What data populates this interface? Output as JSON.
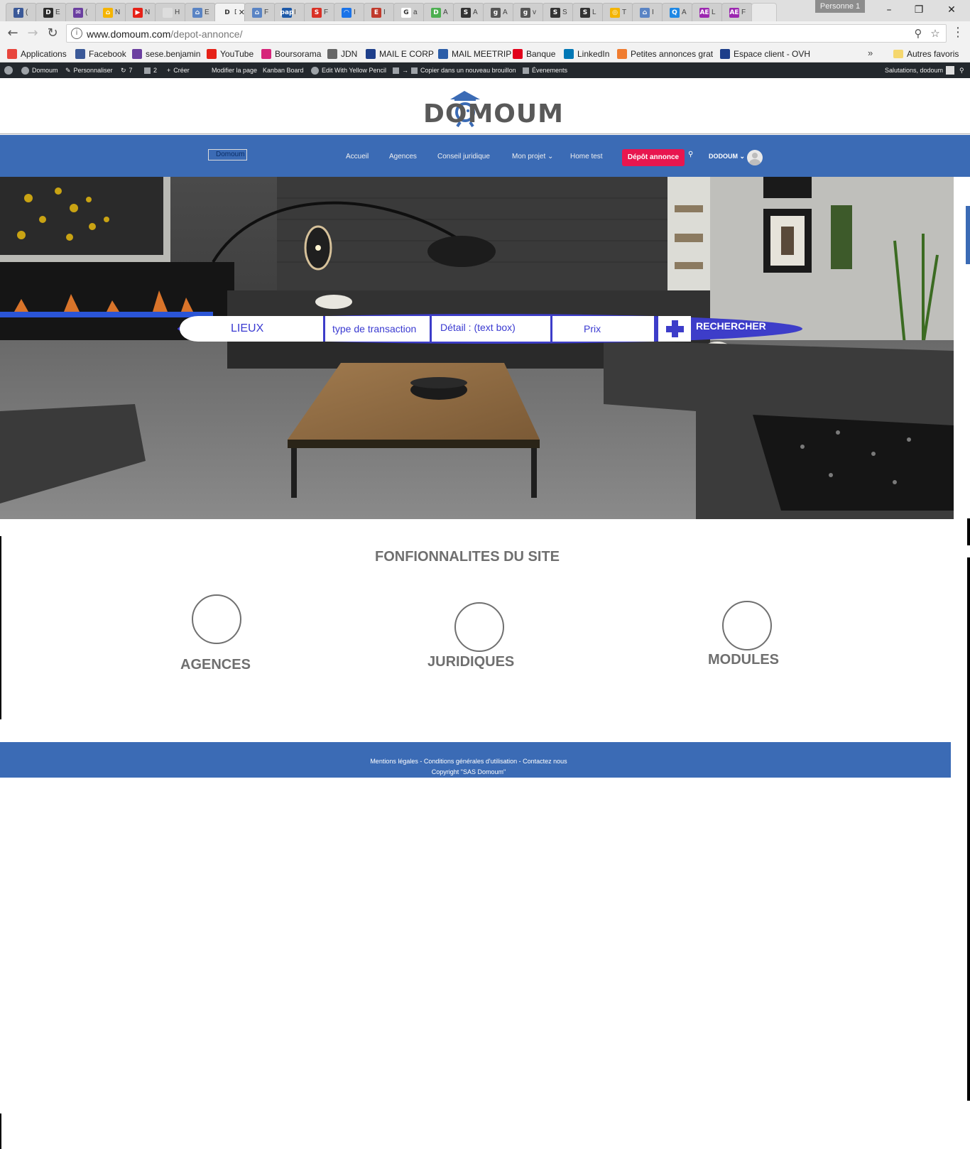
{
  "browser": {
    "tabs": [
      {
        "fav": "f",
        "color": "#3b5998",
        "label": "("
      },
      {
        "fav": "D",
        "color": "#2b2b2b",
        "label": "E"
      },
      {
        "fav": "✉",
        "color": "#6b3fa0",
        "label": "("
      },
      {
        "fav": "⌂",
        "color": "#f5b400",
        "label": "N"
      },
      {
        "fav": "▶",
        "color": "#e62117",
        "label": "N"
      },
      {
        "fav": "",
        "color": "#dddddd",
        "label": "H"
      },
      {
        "fav": "⌂",
        "color": "#5a84c4",
        "label": "E"
      },
      {
        "fav": "D",
        "color": "#f2f2f2",
        "label": "D",
        "active": true
      },
      {
        "fav": "⌂",
        "color": "#5a84c4",
        "label": "F"
      },
      {
        "fav": "pap",
        "color": "#1e5aa8",
        "label": "I"
      },
      {
        "fav": "S",
        "color": "#d93025",
        "label": "F"
      },
      {
        "fav": "◠",
        "color": "#1a73e8",
        "label": "I"
      },
      {
        "fav": "E",
        "color": "#c0392b",
        "label": "I"
      },
      {
        "fav": "G",
        "color": "#ffffff",
        "label": "a"
      },
      {
        "fav": "D",
        "color": "#4caf50",
        "label": "A"
      },
      {
        "fav": "S",
        "color": "#333333",
        "label": "A"
      },
      {
        "fav": "g",
        "color": "#555555",
        "label": "A"
      },
      {
        "fav": "g",
        "color": "#555555",
        "label": "v"
      },
      {
        "fav": "S",
        "color": "#333333",
        "label": "S"
      },
      {
        "fav": "S",
        "color": "#333333",
        "label": "L"
      },
      {
        "fav": "◎",
        "color": "#f4b400",
        "label": "T"
      },
      {
        "fav": "⌂",
        "color": "#5a84c4",
        "label": "I"
      },
      {
        "fav": "Q",
        "color": "#1e88e5",
        "label": "A"
      },
      {
        "fav": "AE",
        "color": "#9c27b0",
        "label": "L"
      },
      {
        "fav": "AE",
        "color": "#9c27b0",
        "label": "F"
      }
    ],
    "profile": "Personne 1",
    "url_host": "www.domoum.com",
    "url_path": "/depot-annonce/",
    "bookmarks": [
      {
        "label": "Applications",
        "icon": "apps-icon",
        "color": "#e8453c"
      },
      {
        "label": "Facebook",
        "icon": "facebook-icon",
        "color": "#3b5998"
      },
      {
        "label": "sese.benjamin",
        "icon": "mail-icon",
        "color": "#6b3fa0"
      },
      {
        "label": "YouTube",
        "icon": "youtube-icon",
        "color": "#e62117"
      },
      {
        "label": "Boursorama",
        "icon": "boursorama-icon",
        "color": "#d6257a"
      },
      {
        "label": "JDN",
        "icon": "jdn-icon",
        "color": "#666666"
      },
      {
        "label": "MAIL E CORP",
        "icon": "ovh-icon",
        "color": "#1d3e8a"
      },
      {
        "label": "MAIL MEETRIP",
        "icon": "meetrip-icon",
        "color": "#2b5da8"
      },
      {
        "label": "Banque",
        "icon": "bank-icon",
        "color": "#e2001a"
      },
      {
        "label": "LinkedIn",
        "icon": "linkedin-icon",
        "color": "#0077b5"
      },
      {
        "label": "Petites annonces grat",
        "icon": "box-icon",
        "color": "#f07c2f"
      },
      {
        "label": "Espace client - OVH",
        "icon": "ovh-icon",
        "color": "#1d3e8a"
      }
    ],
    "bookmarks_more": "»",
    "other_bookmarks": "Autres favoris"
  },
  "wpadmin": {
    "site": "Domoum",
    "customize": "Personnaliser",
    "updates": "7",
    "comments": "2",
    "new": "Créer",
    "edit_page": "Modifier la page",
    "kanban": "Kanban Board",
    "yellow_pencil": "Edit With Yellow Pencil",
    "copy_draft": "Copier dans un nouveau brouillon",
    "events": "Évenements",
    "greeting": "Salutations, dodoum"
  },
  "site": {
    "logo_text": "DOMOUM",
    "nav_logo_alt": "Domoum",
    "nav": {
      "home": "Accueil",
      "agencies": "Agences",
      "legal": "Conseil juridique",
      "project": "Mon projet ⌄",
      "home_test": "Home test",
      "cta": "Dépôt annonce",
      "user": "DODOUM ⌄"
    },
    "search": {
      "place": "LIEUX",
      "transaction": "type de transaction",
      "detail": "Détail : (text box)",
      "price": "Prix",
      "button": "RECHERCHER"
    },
    "features_title": "FONFIONNALITES DU SITE",
    "features": [
      {
        "label": "AGENCES"
      },
      {
        "label": "JURIDIQUES"
      },
      {
        "label": "MODULES"
      }
    ],
    "footer_links": "Mentions légales - Conditions générales d'utilisation - Contactez nous",
    "footer_copyright": "Copyright \"SAS Domoum\""
  },
  "colors": {
    "nav_blue": "#3b6bb5",
    "cta_red": "#e8164f",
    "search_blue": "#3d3dc9",
    "wp_bar": "#23282d"
  }
}
